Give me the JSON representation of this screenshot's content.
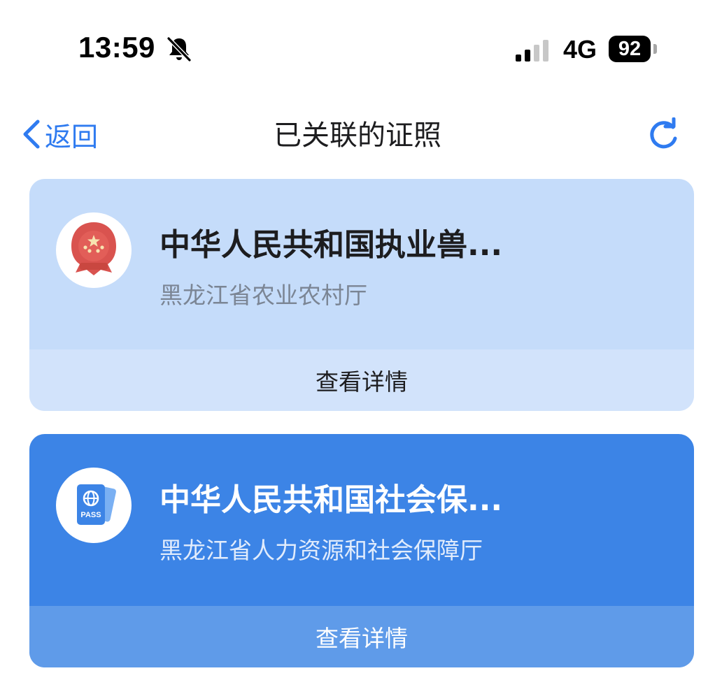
{
  "status_bar": {
    "time": "13:59",
    "network": "4G",
    "battery": "92"
  },
  "nav": {
    "back_label": "返回",
    "title": "已关联的证照"
  },
  "cards": [
    {
      "title": "中华人民共和国执业兽...",
      "issuer": "黑龙江省农业农村厅",
      "action_label": "查看详情",
      "icon": "national-emblem-icon"
    },
    {
      "title": "中华人民共和国社会保...",
      "issuer": "黑龙江省人力资源和社会保障厅",
      "action_label": "查看详情",
      "icon": "passport-icon",
      "icon_text": "PASS"
    }
  ],
  "colors": {
    "accent": "#2f7bf0",
    "card1_bg": "#c5dcfa",
    "card2_bg": "#3c84e6"
  }
}
